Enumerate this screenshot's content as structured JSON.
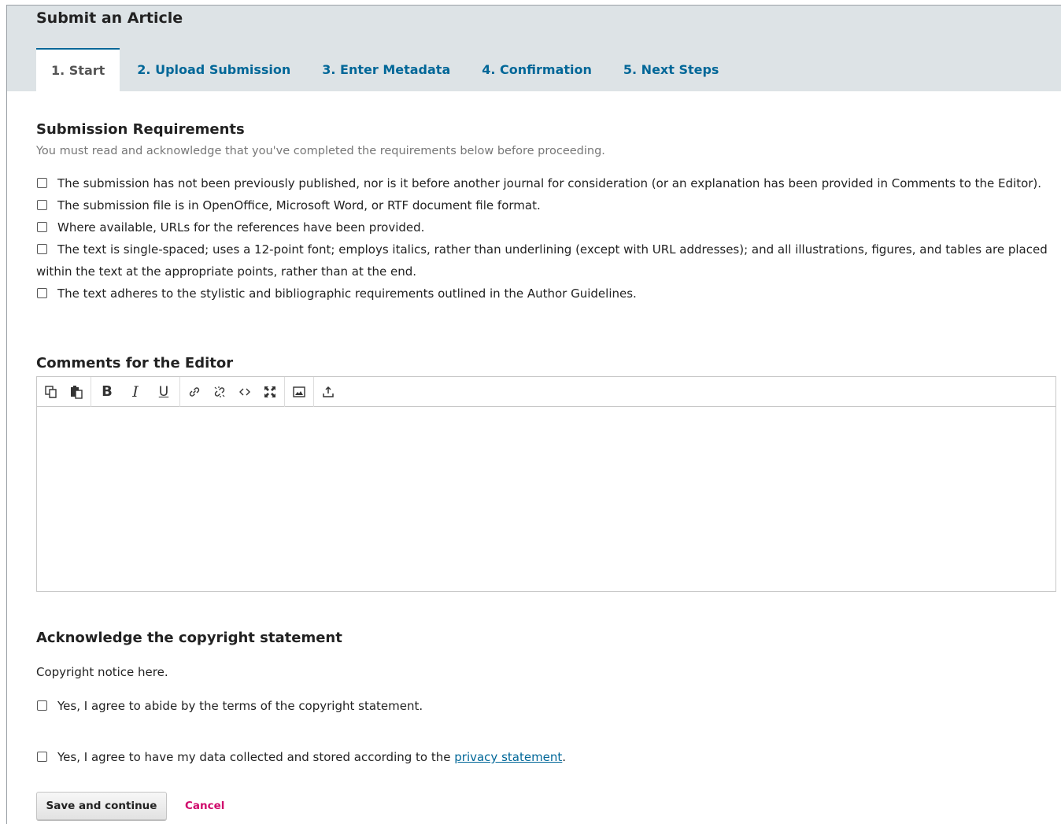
{
  "page": {
    "title": "Submit an Article"
  },
  "tabs": [
    {
      "label": "1. Start",
      "active": true
    },
    {
      "label": "2. Upload Submission"
    },
    {
      "label": "3. Enter Metadata"
    },
    {
      "label": "4. Confirmation"
    },
    {
      "label": "5. Next Steps"
    }
  ],
  "requirements": {
    "title": "Submission Requirements",
    "description": "You must read and acknowledge that you've completed the requirements below before proceeding.",
    "items": [
      "The submission has not been previously published, nor is it before another journal for consideration (or an explanation has been provided in Comments to the Editor).",
      "The submission file is in OpenOffice, Microsoft Word, or RTF document file format.",
      "Where available, URLs for the references have been provided.",
      "The text is single-spaced; uses a 12-point font; employs italics, rather than underlining (except with URL addresses); and all illustrations, figures, and tables are placed within the text at the appropriate points, rather than at the end.",
      "The text adheres to the stylistic and bibliographic requirements outlined in the Author Guidelines."
    ]
  },
  "comments": {
    "title": "Comments for the Editor",
    "value": "",
    "toolbar": [
      "copy-icon",
      "paste-icon",
      "bold-icon",
      "italic-icon",
      "underline-icon",
      "link-icon",
      "unlink-icon",
      "code-icon",
      "fullscreen-icon",
      "image-icon",
      "upload-icon"
    ]
  },
  "copyright": {
    "title": "Acknowledge the copyright statement",
    "notice": "Copyright notice here.",
    "agree_label": "Yes, I agree to abide by the terms of the copyright statement."
  },
  "privacy": {
    "prefix": "Yes, I agree to have my data collected and stored according to the ",
    "link": "privacy statement",
    "suffix": "."
  },
  "actions": {
    "save": "Save and continue",
    "cancel": "Cancel"
  },
  "colors": {
    "accent": "#006798",
    "header_bg": "#dde3e6",
    "cancel": "#d00a6c"
  }
}
